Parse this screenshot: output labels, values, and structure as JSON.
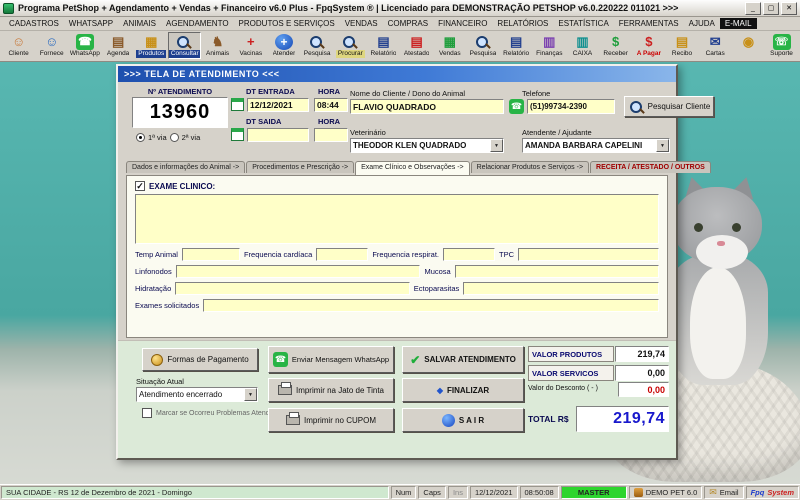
{
  "titlebar": {
    "title": "Programa PetShop + Agendamento + Vendas + Financeiro v6.0 Plus - FpqSystem ® | Licenciado para DEMONSTRAÇÃO PETSHOP v6.0.220222 011021 >>>",
    "min": "_",
    "max": "▢",
    "close": "✕"
  },
  "menu": [
    {
      "label": "CADASTROS"
    },
    {
      "label": "WHATSAPP"
    },
    {
      "label": "ANIMAIS"
    },
    {
      "label": "AGENDAMENTO"
    },
    {
      "label": "PRODUTOS E SERVIÇOS"
    },
    {
      "label": "VENDAS"
    },
    {
      "label": "COMPRAS"
    },
    {
      "label": "FINANCEIRO"
    },
    {
      "label": "RELATÓRIOS"
    },
    {
      "label": "ESTATÍSTICA"
    },
    {
      "label": "FERRAMENTAS"
    },
    {
      "label": "AJUDA"
    },
    {
      "label": "E-MAIL",
      "cls": "mi-dark"
    }
  ],
  "toolbar": [
    {
      "label": "Cliente",
      "icon": "client-icon",
      "glyph": "☺",
      "ic": "c-skin"
    },
    {
      "label": "Fornece",
      "icon": "supplier-icon",
      "glyph": "☺",
      "ic": "c-blue"
    },
    {
      "label": "WhatsApp",
      "icon": "whatsapp-icon",
      "glyph": "☎",
      "ic": "tile-green"
    },
    {
      "label": "Agenda",
      "icon": "agenda-icon",
      "glyph": "▤",
      "ic": "c-brown"
    },
    {
      "label": "Produtos",
      "icon": "products-icon",
      "glyph": "▦",
      "ic": "c-gold",
      "lbl": "lbl-inv"
    },
    {
      "label": "Consultar",
      "icon": "search-products-icon",
      "glyph": "",
      "ic": "ic-mag",
      "lbl": "lbl-inv",
      "cls": "pressed"
    },
    {
      "label": "Animais",
      "icon": "animals-icon",
      "glyph": "♞",
      "ic": "c-brown"
    },
    {
      "label": "Vacinas",
      "icon": "vaccines-icon",
      "glyph": "+",
      "ic": "c-red"
    },
    {
      "label": "Atender",
      "icon": "attend-icon",
      "glyph": "+",
      "ic": "tile-blue"
    },
    {
      "label": "Pesquisa",
      "icon": "search-icon",
      "glyph": "",
      "ic": "ic-mag"
    },
    {
      "label": "Procurar",
      "icon": "find-icon",
      "glyph": "",
      "ic": "ic-mag",
      "lbl": "lbl-hl"
    },
    {
      "label": "Relatório",
      "icon": "report-icon",
      "glyph": "▤",
      "ic": "c-navy"
    },
    {
      "label": "Atestado",
      "icon": "certificate-icon",
      "glyph": "▤",
      "ic": "c-red"
    },
    {
      "label": "Vendas",
      "icon": "sales-icon",
      "glyph": "▦",
      "ic": "c-green"
    },
    {
      "label": "Pesquisa",
      "icon": "search-sales-icon",
      "glyph": "",
      "ic": "ic-mag"
    },
    {
      "label": "Relatório",
      "icon": "sales-report-icon",
      "glyph": "▤",
      "ic": "c-navy"
    },
    {
      "label": "Finanças",
      "icon": "finance-icon",
      "glyph": "▥",
      "ic": "c-purple"
    },
    {
      "label": "CAIXA",
      "icon": "cashier-icon",
      "glyph": "▥",
      "ic": "c-teal"
    },
    {
      "label": "Receber",
      "icon": "receive-icon",
      "glyph": "$",
      "ic": "c-green"
    },
    {
      "label": "A Pagar",
      "icon": "pay-icon",
      "glyph": "$",
      "ic": "c-red",
      "lbl": "lbl-red"
    },
    {
      "label": "Recibo",
      "icon": "receipt-icon",
      "glyph": "▤",
      "ic": "c-gold"
    },
    {
      "label": "Cartas",
      "icon": "letters-icon",
      "glyph": "✉",
      "ic": "c-navy"
    },
    {
      "label": "",
      "icon": "coins-icon",
      "glyph": "◉",
      "ic": "c-gold"
    },
    {
      "label": "Suporte",
      "icon": "support-icon",
      "glyph": "☏",
      "ic": "tile-green"
    }
  ],
  "win": {
    "title": ">>>   TELA DE ATENDIMENTO   <<<",
    "header": {
      "atendimento_label": "Nº ATENDIMENTO",
      "atendimento_numero": "13960",
      "via1": "1ª via",
      "via2": "2ª via",
      "dt_entrada_label": "DT ENTRADA",
      "hora_entrada_label": "HORA",
      "dt_entrada": "12/12/2021",
      "hora_entrada": "08:44",
      "dt_saida_label": "DT SAIDA",
      "hora_saida_label": "HORA",
      "dt_saida": "",
      "hora_saida": "",
      "cliente_label": "Nome do Cliente / Dono do Animal",
      "cliente": "FLAVIO QUADRADO",
      "telefone_label": "Telefone",
      "telefone": "(51)99734-2390",
      "pesquisar_cliente": "Pesquisar Cliente",
      "veterinario_label": "Veterinário",
      "veterinario": "THEODOR KLEN QUADRADO",
      "atendente_label": "Atendente / Ajudante",
      "atendente": "AMANDA BARBARA CAPELINI"
    },
    "tabs": [
      "Dados e informações do Animal  ->",
      "Procedimentos e Prescrição  ->",
      "Exame Clínico e Observações  ->",
      "Relacionar Produtos e Serviços  ->",
      "RECEITA / ATESTADO / OUTROS"
    ],
    "exam": {
      "checkbox_label": "EXAME CLINICO:",
      "notes": "",
      "temp_label": "Temp Animal",
      "temp_value": "",
      "freq_card_label": "Frequencia cardíaca",
      "freq_card_value": "",
      "freq_resp_label": "Frequencia respirat.",
      "freq_resp_value": "",
      "tpc_label": "TPC",
      "tpc_value": "",
      "linfonodos_label": "Linfonodos",
      "linfonodos_value": "",
      "mucosa_label": "Mucosa",
      "mucosa_value": "",
      "hidratacao_label": "Hidratação",
      "hidratacao_value": "",
      "ectoparasitas_label": "Ectoparasitas",
      "ectoparasitas_value": "",
      "exames_label": "Exames solicitados",
      "exames_value": ""
    },
    "actions": {
      "formas_pagamento": "Formas de Pagamento",
      "whatsapp_msg": "Enviar Mensagem WhatsApp",
      "salvar": "SALVAR  ATENDIMENTO",
      "situacao_label": "Situação Atual",
      "situacao_value": "Atendimento encerrado",
      "problemas_label": "Marcar se Ocorreu Problemas Atendimento",
      "imprimir_jato": "Imprimir na Jato de Tinta",
      "finalizar": "FINALIZAR",
      "imprimir_cupom": "Imprimir no CUPOM",
      "sair": "S A I R"
    },
    "totals": {
      "valor_produtos_label": "VALOR PRODUTOS",
      "valor_produtos": "219,74",
      "valor_servicos_label": "VALOR SERVICOS",
      "valor_servicos": "0,00",
      "desconto_label": "Valor do Desconto ( - )",
      "desconto": "0,00",
      "total_label": "TOTAL R$",
      "total": "219,74"
    }
  },
  "statusbar": {
    "left": "SUA CIDADE - RS 12 de Dezembro de 2021 - Domingo",
    "num": "Num",
    "caps": "Caps",
    "ins": "Ins",
    "date": "12/12/2021",
    "time": "08:50:08",
    "master": "MASTER",
    "demo": "DEMO PET 6.0",
    "email": "Email",
    "email_glyph": "✉",
    "brand_fpq": "Fpq",
    "brand_sys": "System"
  },
  "colors": {
    "accent_green": "#28b446",
    "titlebar_blue": "#1e4fae",
    "field_yellow": "#ffffc8",
    "total_blue": "#1818cc",
    "discount_red": "#c80000",
    "wall_teal": "#49a7a1",
    "master_green": "#2ed52e"
  }
}
